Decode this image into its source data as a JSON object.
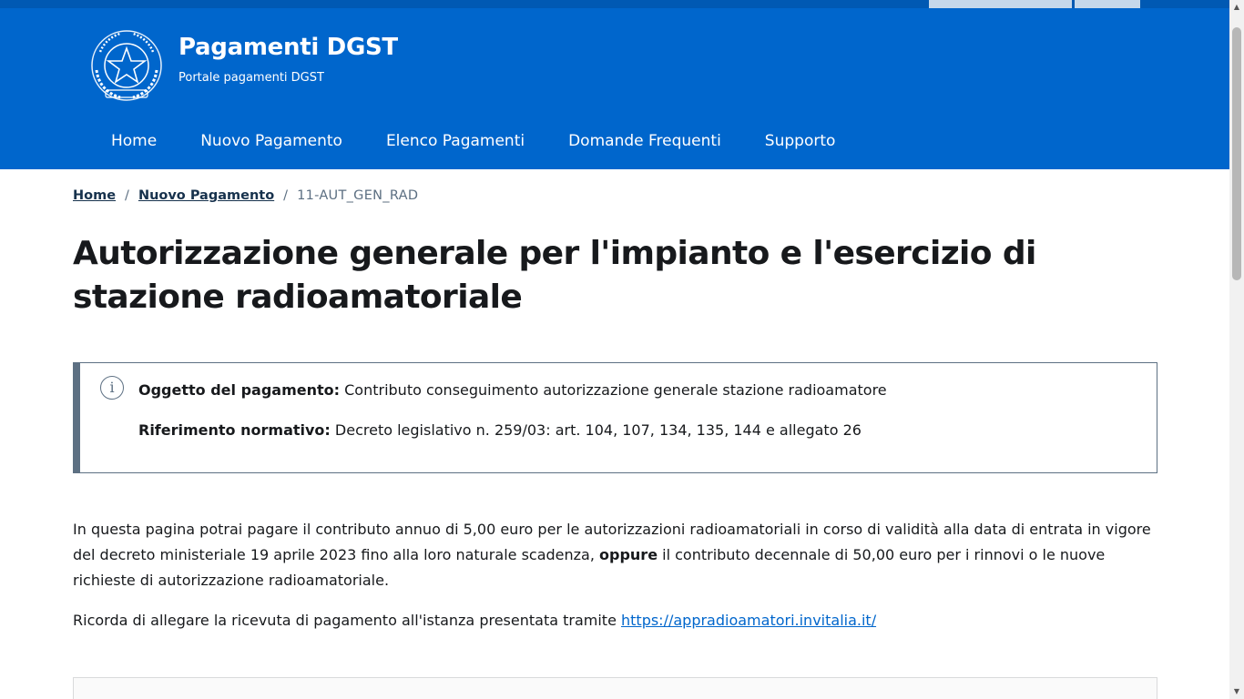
{
  "header": {
    "title": "Pagamenti DGST",
    "subtitle": "Portale pagamenti DGST",
    "brand_color": "#0066cc"
  },
  "nav": {
    "items": [
      {
        "label": "Home"
      },
      {
        "label": "Nuovo Pagamento"
      },
      {
        "label": "Elenco Pagamenti"
      },
      {
        "label": "Domande Frequenti"
      },
      {
        "label": "Supporto"
      }
    ]
  },
  "breadcrumb": {
    "home": "Home",
    "nuovo": "Nuovo Pagamento",
    "current": "11-AUT_GEN_RAD",
    "separator": "/"
  },
  "page": {
    "title": "Autorizzazione generale per l'impianto e l'esercizio di stazione radioamatoriale"
  },
  "callout": {
    "icon": "info-icon",
    "oggetto_label": "Oggetto del pagamento:",
    "oggetto_value": "Contributo conseguimento autorizzazione generale stazione radioamatore",
    "riferimento_label": "Riferimento normativo:",
    "riferimento_value": "Decreto legislativo n. 259/03: art. 104, 107, 134, 135, 144 e allegato 26"
  },
  "content": {
    "p1_start": "In questa pagina potrai pagare il contributo annuo di 5,00 euro per le autorizzazioni radioamatoriali in corso di validità alla data di entrata in vigore del decreto ministeriale 19 aprile 2023 fino alla loro naturale scadenza, ",
    "p1_bold": "oppure",
    "p1_end": " il contributo decennale di 50,00 euro per i rinnovi o le nuove richieste di autorizzazione radioamatoriale.",
    "p2_start": "Ricorda di allegare la ricevuta di pagamento all'istanza presentata tramite ",
    "p2_link": "https://appradioamatori.invitalia.it/"
  }
}
